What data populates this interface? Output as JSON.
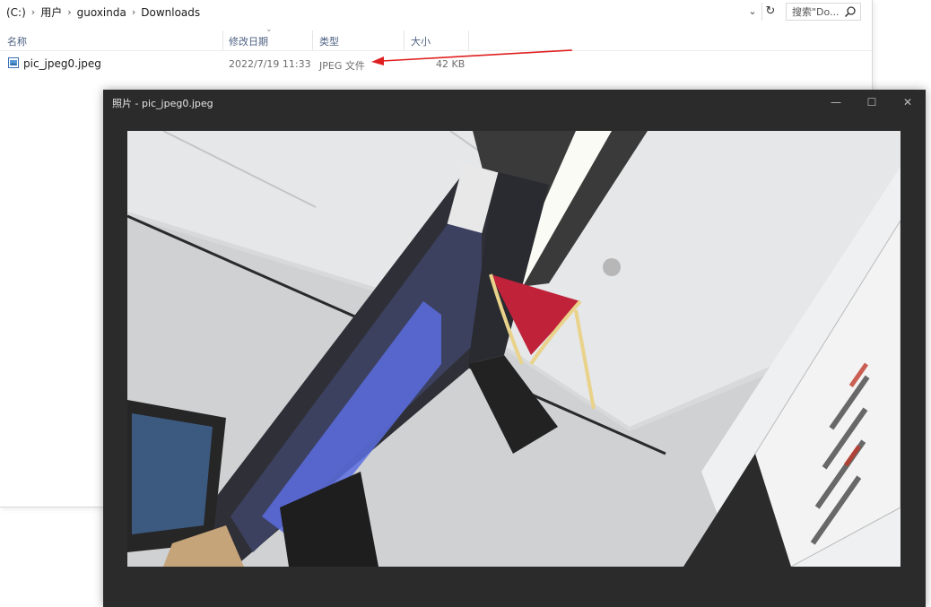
{
  "explorer": {
    "breadcrumb": [
      "(C:)",
      "用户",
      "guoxinda",
      "Downloads"
    ],
    "search": {
      "placeholder": "搜索\"Do..."
    },
    "columns": {
      "name": "名称",
      "modified": "修改日期",
      "type": "类型",
      "size": "大小"
    },
    "files": [
      {
        "name": "pic_jpeg0.jpeg",
        "modified": "2022/7/19 11:33",
        "type": "JPEG 文件",
        "size": "42 KB"
      }
    ],
    "icons": {
      "search": "search-icon",
      "refresh": "refresh-icon",
      "dropdown": "chevron-down-icon",
      "file": "image-file-icon"
    },
    "annotation_color": "#e02020"
  },
  "photo_viewer": {
    "title": "照片 - pic_jpeg0.jpeg",
    "controls": {
      "minimize": "—",
      "maximize": "☐",
      "close": "✕"
    },
    "background": "#2b2b2b"
  }
}
